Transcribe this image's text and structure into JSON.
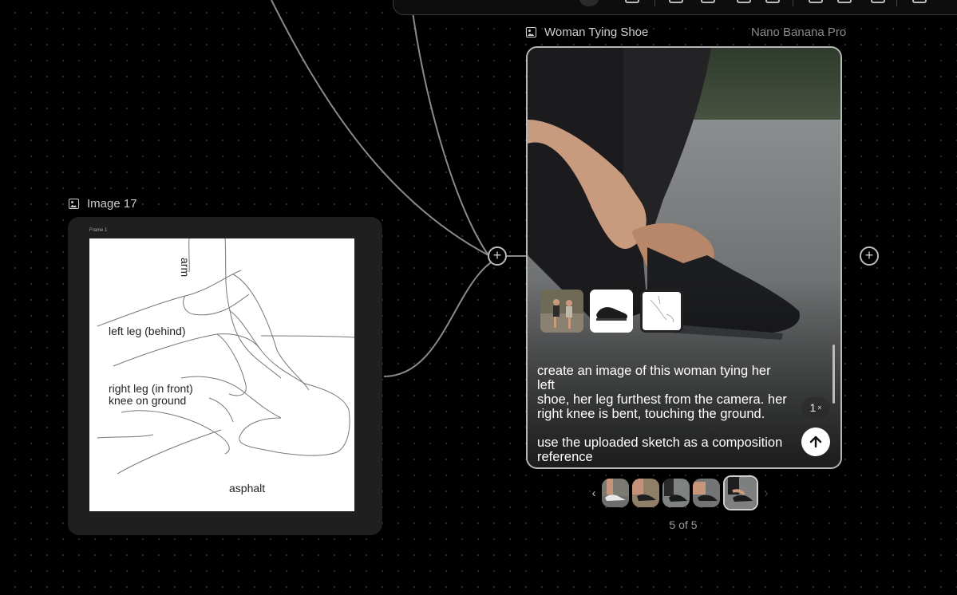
{
  "toolbar": {
    "icons": [
      "toolbar-tool-icon",
      "toolbar-chart-icon",
      "toolbar-link-icon",
      "toolbar-add-icon",
      "toolbar-doc-icon",
      "toolbar-image-icon",
      "toolbar-edit-icon",
      "toolbar-history-icon",
      "toolbar-more-icon"
    ]
  },
  "left_node": {
    "title": "Image 17",
    "frame_label": "Frame 1",
    "sketch_labels": {
      "arm": "arm",
      "left_leg": "left leg (behind)",
      "right_leg": "right leg (in front)\nknee on ground",
      "asphalt": "asphalt"
    }
  },
  "main_node": {
    "title": "Woman Tying Shoe",
    "model": "Nano Banana Pro",
    "reference_thumbnails": [
      "runners-thumbnail",
      "shoe-thumbnail",
      "sketch-thumbnail"
    ],
    "prompt": "create an image of this woman tying her left\nshoe, her leg furthest from the camera. her\nright knee is bent, touching the ground.\n\nuse the uploaded sketch as a composition\nreference",
    "multiplier": "1",
    "multiplier_symbol": "×"
  },
  "carousel": {
    "counter": "5 of 5",
    "current": 5,
    "total": 5,
    "prev_icon": "chevron-left-icon",
    "next_icon": "chevron-right-icon"
  },
  "colors": {
    "canvas": "#000000",
    "node": "#1f1f1f",
    "wire": "#8f8f8f",
    "accent_border": "#b8b8b8"
  }
}
